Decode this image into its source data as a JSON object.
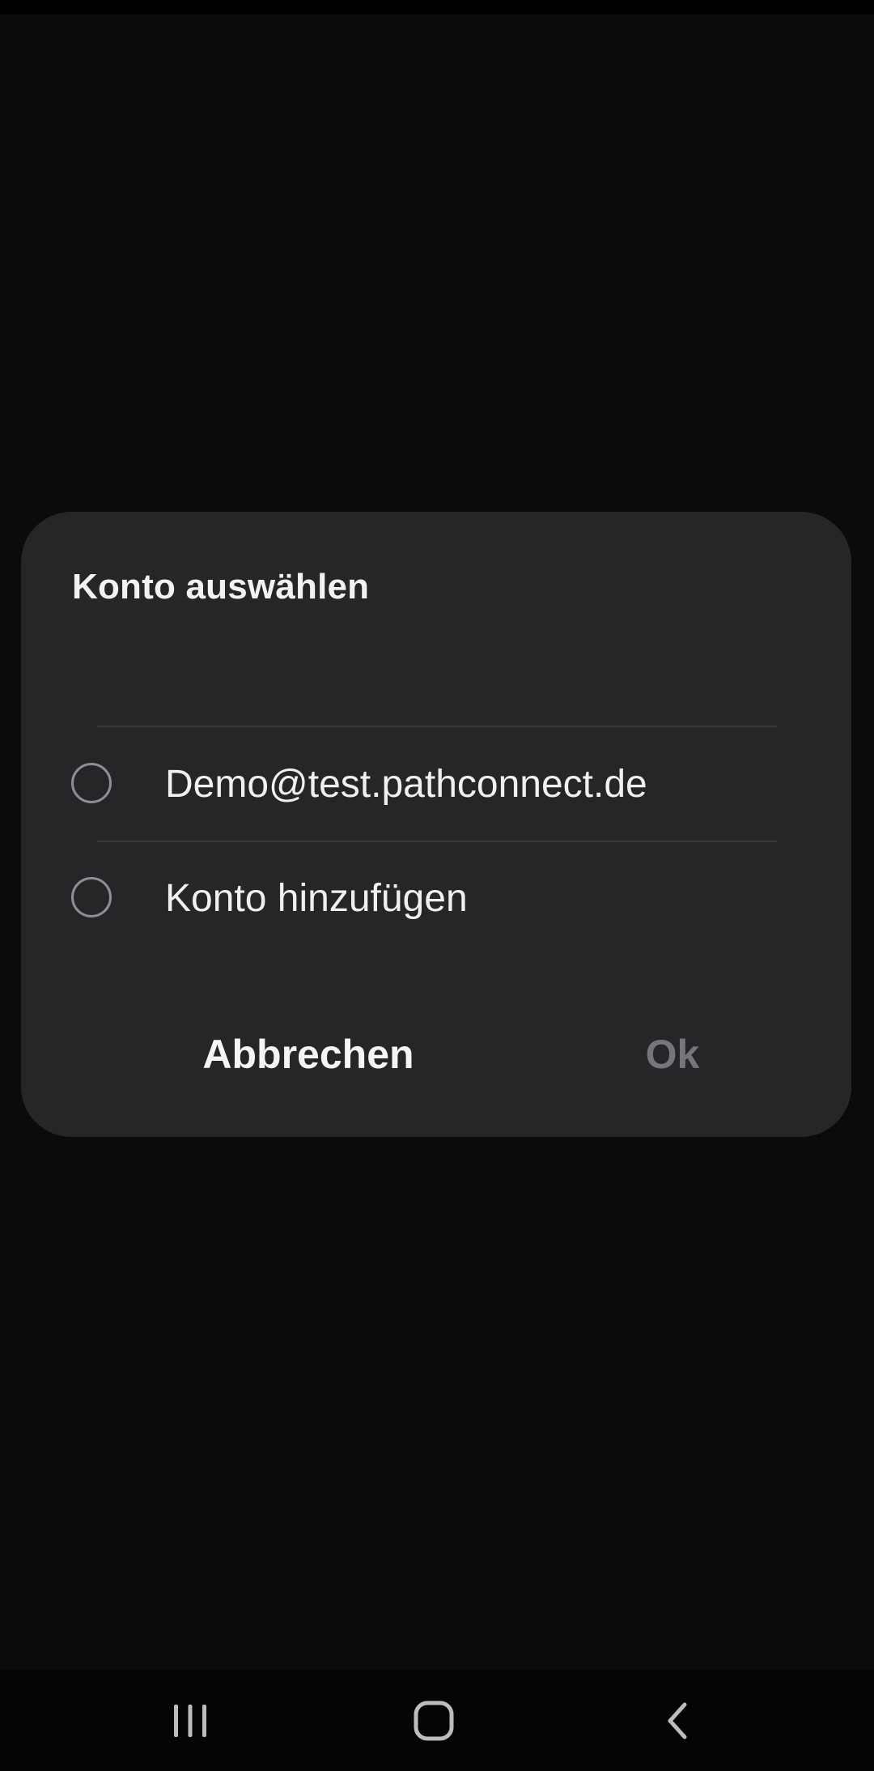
{
  "dialog": {
    "title": "Konto auswählen",
    "options": [
      {
        "label": "Demo@test.pathconnect.de",
        "selected": false
      },
      {
        "label": "Konto hinzufügen",
        "selected": false
      }
    ],
    "cancel_label": "Abbrechen",
    "ok_label": "Ok",
    "ok_enabled": false
  },
  "navigation": {
    "recent_apps_icon": "recent-apps-icon",
    "home_icon": "home-icon",
    "back_icon": "back-icon"
  },
  "colors": {
    "background": "#0b0b0d",
    "dialog_background": "#262628",
    "text_primary": "#f0f0f0",
    "text_disabled": "#76767a"
  }
}
